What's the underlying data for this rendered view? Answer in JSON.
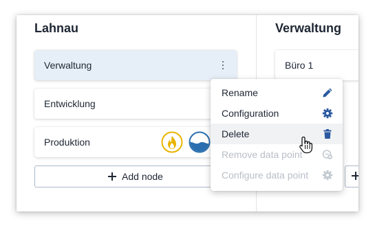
{
  "columns": [
    {
      "title": "Lahnau",
      "nodes": [
        {
          "label": "Verwaltung"
        },
        {
          "label": "Entwicklung"
        },
        {
          "label": "Produktion",
          "datapoints": [
            "flame-icon",
            "water-icon"
          ]
        }
      ],
      "add_label": "Add node"
    },
    {
      "title": "Verwaltung",
      "nodes": [
        {
          "label": "Büro 1"
        }
      ]
    }
  ],
  "context_menu": {
    "items": [
      {
        "label": "Rename",
        "icon": "pencil-icon",
        "enabled": true
      },
      {
        "label": "Configuration",
        "icon": "gear-icon",
        "enabled": true
      },
      {
        "label": "Delete",
        "icon": "trash-icon",
        "enabled": true,
        "hovered": true
      },
      {
        "label": "Remove data point",
        "icon": "remove-datapoint-icon",
        "enabled": false
      },
      {
        "label": "Configure data point",
        "icon": "gear-icon",
        "enabled": false
      }
    ]
  },
  "colors": {
    "icon_blue": "#2b5aa0",
    "flame_yellow": "#e8b400",
    "water_blue": "#2b6fb0",
    "selected_bg": "#e6eef7",
    "disabled": "#b8bec6"
  }
}
